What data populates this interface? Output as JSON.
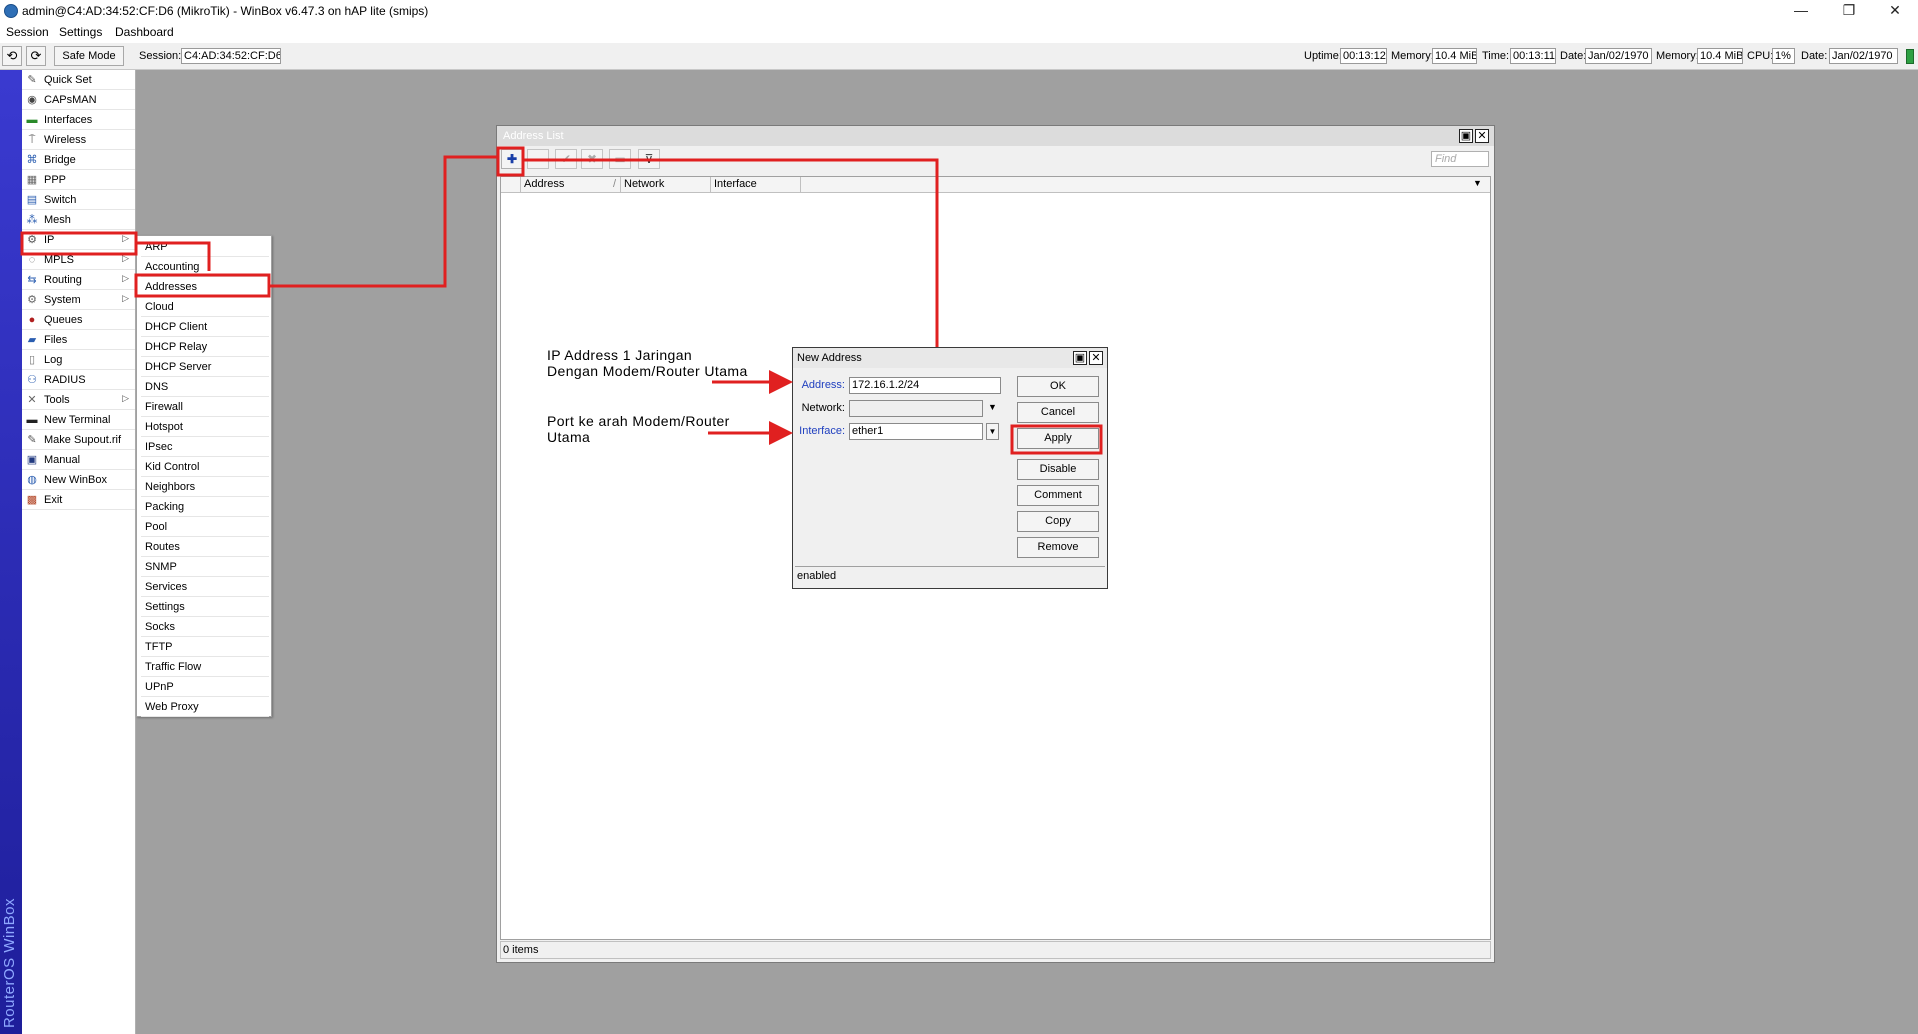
{
  "window": {
    "title": "admin@C4:AD:34:52:CF:D6 (MikroTik) - WinBox v6.47.3 on hAP lite (smips)",
    "minimize": "—",
    "maximize": "❐",
    "close": "✕"
  },
  "menubar": [
    "Session",
    "Settings",
    "Dashboard"
  ],
  "toolbar": {
    "undo_icon": "⟲",
    "redo_icon": "⟳",
    "safe_mode": "Safe Mode",
    "session_label": "Session:",
    "session_value": "C4:AD:34:52:CF:D6",
    "stats": [
      {
        "label": "Uptime:",
        "value": "00:13:12"
      },
      {
        "label": "Memory:",
        "value": "10.4 MiB"
      },
      {
        "label": "Time:",
        "value": "00:13:11"
      },
      {
        "label": "Date:",
        "value": "Jan/02/1970"
      },
      {
        "label": "Memory:",
        "value": "10.4 MiB"
      },
      {
        "label": "CPU:",
        "value": "1%"
      },
      {
        "label": "Date:",
        "value": "Jan/02/1970"
      }
    ]
  },
  "brand": "RouterOS WinBox",
  "main_menu": [
    {
      "label": "Quick Set",
      "icon": "wand-icon",
      "glyph": "✎",
      "color": "#555"
    },
    {
      "label": "CAPsMAN",
      "icon": "capsman-icon",
      "glyph": "◉",
      "color": "#444"
    },
    {
      "label": "Interfaces",
      "icon": "interfaces-icon",
      "glyph": "▬",
      "color": "#2a8a2a"
    },
    {
      "label": "Wireless",
      "icon": "wireless-icon",
      "glyph": "⍑",
      "color": "#555"
    },
    {
      "label": "Bridge",
      "icon": "bridge-icon",
      "glyph": "⌘",
      "color": "#2a5db0"
    },
    {
      "label": "PPP",
      "icon": "ppp-icon",
      "glyph": "▦",
      "color": "#666"
    },
    {
      "label": "Switch",
      "icon": "switch-icon",
      "glyph": "▤",
      "color": "#2a5db0"
    },
    {
      "label": "Mesh",
      "icon": "mesh-icon",
      "glyph": "⁂",
      "color": "#2a5db0"
    },
    {
      "label": "IP",
      "icon": "ip-icon",
      "glyph": "⚙",
      "color": "#555",
      "submenu": true
    },
    {
      "label": "MPLS",
      "icon": "mpls-icon",
      "glyph": "◌",
      "color": "#555",
      "submenu": true
    },
    {
      "label": "Routing",
      "icon": "routing-icon",
      "glyph": "⇆",
      "color": "#2a5db0",
      "submenu": true
    },
    {
      "label": "System",
      "icon": "system-icon",
      "glyph": "⚙",
      "color": "#666",
      "submenu": true
    },
    {
      "label": "Queues",
      "icon": "queues-icon",
      "glyph": "●",
      "color": "#b02020"
    },
    {
      "label": "Files",
      "icon": "files-icon",
      "glyph": "▰",
      "color": "#2a5db0"
    },
    {
      "label": "Log",
      "icon": "log-icon",
      "glyph": "▯",
      "color": "#777"
    },
    {
      "label": "RADIUS",
      "icon": "radius-icon",
      "glyph": "⚇",
      "color": "#2a5db0"
    },
    {
      "label": "Tools",
      "icon": "tools-icon",
      "glyph": "✕",
      "color": "#666",
      "submenu": true
    },
    {
      "label": "New Terminal",
      "icon": "terminal-icon",
      "glyph": "▬",
      "color": "#222"
    },
    {
      "label": "Make Supout.rif",
      "icon": "supout-icon",
      "glyph": "✎",
      "color": "#555"
    },
    {
      "label": "Manual",
      "icon": "manual-icon",
      "glyph": "▣",
      "color": "#223a80"
    },
    {
      "label": "New WinBox",
      "icon": "winbox-icon",
      "glyph": "◍",
      "color": "#2a5db0"
    },
    {
      "label": "Exit",
      "icon": "exit-icon",
      "glyph": "▩",
      "color": "#b04020"
    }
  ],
  "submenu": [
    "ARP",
    "Accounting",
    "Addresses",
    "Cloud",
    "DHCP Client",
    "DHCP Relay",
    "DHCP Server",
    "DNS",
    "Firewall",
    "Hotspot",
    "IPsec",
    "Kid Control",
    "Neighbors",
    "Packing",
    "Pool",
    "Routes",
    "SNMP",
    "Services",
    "Settings",
    "Socks",
    "TFTP",
    "Traffic Flow",
    "UPnP",
    "Web Proxy"
  ],
  "address_list": {
    "title": "Address List",
    "restore": "▣",
    "close": "✕",
    "toolbar": {
      "add": "✚",
      "remove": "−",
      "enable": "✔",
      "disable": "✖",
      "comment": "▭",
      "filter": "⊽"
    },
    "find_placeholder": "Find",
    "columns": [
      "Address",
      "Network",
      "Interface"
    ],
    "sort_indicator": "/",
    "column_menu": "▼",
    "status": "0 items"
  },
  "new_address": {
    "title": "New Address",
    "restore": "▣",
    "close": "✕",
    "address_label": "Address:",
    "address_value": "172.16.1.2/24",
    "network_label": "Network:",
    "network_value": "",
    "interface_label": "Interface:",
    "interface_value": "ether1",
    "dropdown_glyph": "▼",
    "buttons": [
      "OK",
      "Cancel",
      "Apply",
      "Disable",
      "Comment",
      "Copy",
      "Remove"
    ],
    "status": "enabled"
  },
  "annotations": {
    "note1_line1": "IP Address 1 Jaringan",
    "note1_line2": "Dengan Modem/Router Utama",
    "note2_line1": "Port ke arah Modem/Router",
    "note2_line2": "Utama"
  },
  "colors": {
    "highlight": "#e02020",
    "field_label_blue": "#1f3fbf",
    "add_icon": "#1a3fa8"
  }
}
